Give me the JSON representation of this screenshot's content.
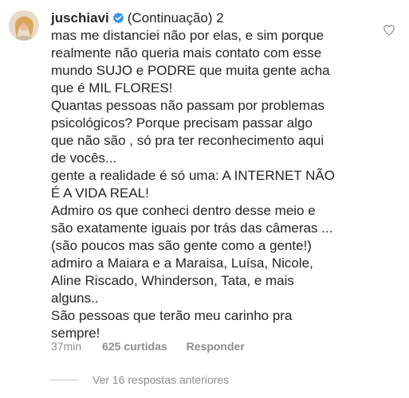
{
  "comment": {
    "username": "juschiavi",
    "header_rest": "(Continuação) 2",
    "paragraphs": [
      "mas me distanciei não por elas, e sim porque\nrealmente não queria mais contato com esse\nmundo SUJO e PODRE que muita gente acha\nque é MIL FLORES!",
      "Quantas pessoas não passam por problemas\npsicológicos? Porque precisam passar algo\nque não são , só pra ter reconhecimento aqui\nde vocês...",
      "gente a realidade é só uma: A INTERNET NÃO\nÉ A VIDA REAL!",
      "Admiro os que conheci dentro desse meio e\nsão exatamente iguais por trás das câmeras ...\n(são poucos mas são gente como a gente!)\nadmiro a Maiara e a Maraisa, Luísa, Nicole,\nAline Riscado, Whinderson, Tata, e mais\nalguns..",
      "São pessoas que terão meu carinho pra\nsempre!"
    ],
    "time": "37min",
    "likes": "625 curtidas",
    "reply_label": "Responder",
    "view_replies": "Ver 16 respostas anteriores"
  },
  "icons": {
    "verified": "verified-badge-icon",
    "like": "heart-icon"
  },
  "colors": {
    "text": "#262626",
    "secondary": "#8e8e8e",
    "verified_blue": "#3897f0"
  }
}
